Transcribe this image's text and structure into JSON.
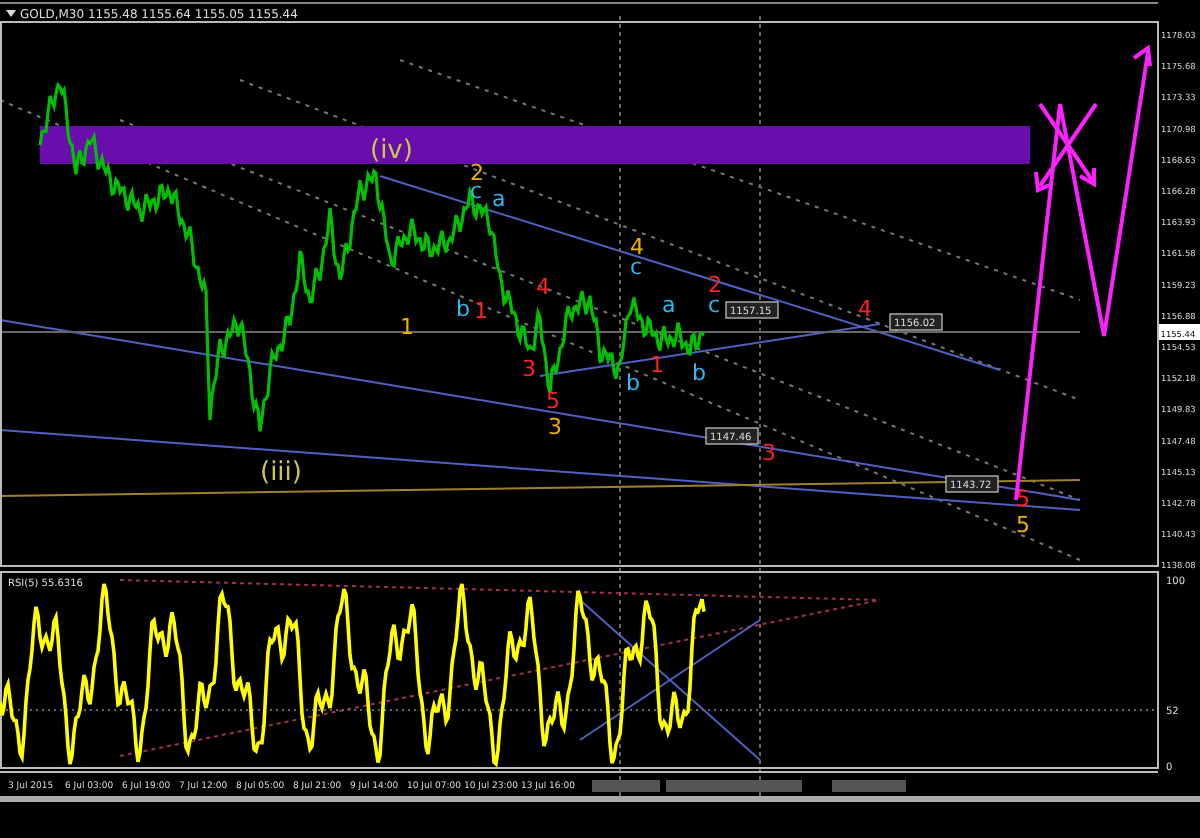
{
  "symbol_bar": {
    "title": "GOLD,M30 1155.48 1155.64 1155.05 1155.44"
  },
  "price_axis": {
    "labels": [
      "1178.03",
      "1175.68",
      "1173.33",
      "1170.98",
      "1168.63",
      "1166.28",
      "1163.93",
      "1161.58",
      "1159.23",
      "1156.88",
      "1154.53",
      "1152.18",
      "1149.83",
      "1147.48",
      "1145.13",
      "1142.78",
      "1140.43",
      "1138.08"
    ],
    "current_price": "1155.44"
  },
  "wave_labels": [
    {
      "text": "(iv)",
      "color": "#c8c850"
    },
    {
      "text": "2",
      "color": "#f0b000"
    },
    {
      "text": "c",
      "color": "#30b8f0"
    },
    {
      "text": "a",
      "color": "#30b8f0"
    },
    {
      "text": "b",
      "color": "#30b8f0"
    },
    {
      "text": "1",
      "color": "#ff2020"
    },
    {
      "text": "1",
      "color": "#f0b000"
    },
    {
      "text": "4",
      "color": "#ff2020"
    },
    {
      "text": "3",
      "color": "#ff2020"
    },
    {
      "text": "5",
      "color": "#ff2020"
    },
    {
      "text": "3",
      "color": "#f0b000"
    },
    {
      "text": "4",
      "color": "#f0b000"
    },
    {
      "text": "c",
      "color": "#30b8f0"
    },
    {
      "text": "a",
      "color": "#30b8f0"
    },
    {
      "text": "b",
      "color": "#30b8f0"
    },
    {
      "text": "1",
      "color": "#ff2020"
    },
    {
      "text": "2",
      "color": "#ff2020"
    },
    {
      "text": "c",
      "color": "#30b8f0"
    },
    {
      "text": "b",
      "color": "#30b8f0"
    },
    {
      "text": "4",
      "color": "#ff2020"
    },
    {
      "text": "3",
      "color": "#ff2020"
    },
    {
      "text": "(iii)",
      "color": "#c8c850"
    },
    {
      "text": "5",
      "color": "#ff2020"
    },
    {
      "text": "5",
      "color": "#f0b000"
    }
  ],
  "price_tags": [
    "1157.15",
    "1156.02",
    "1147.46",
    "1143.72"
  ],
  "indicator": {
    "title": "RSI(5) 55.6316",
    "axis_labels": [
      "100",
      "52",
      "0"
    ]
  },
  "time_axis": {
    "labels": [
      "3 Jul 2015",
      "6 Jul 03:00",
      "6 Jul 19:00",
      "7 Jul 12:00",
      "8 Jul 05:00",
      "8 Jul 21:00",
      "9 Jul 14:00",
      "10 Jul 07:00",
      "10 Jul 23:00",
      "13 Jul 16:00"
    ]
  }
}
